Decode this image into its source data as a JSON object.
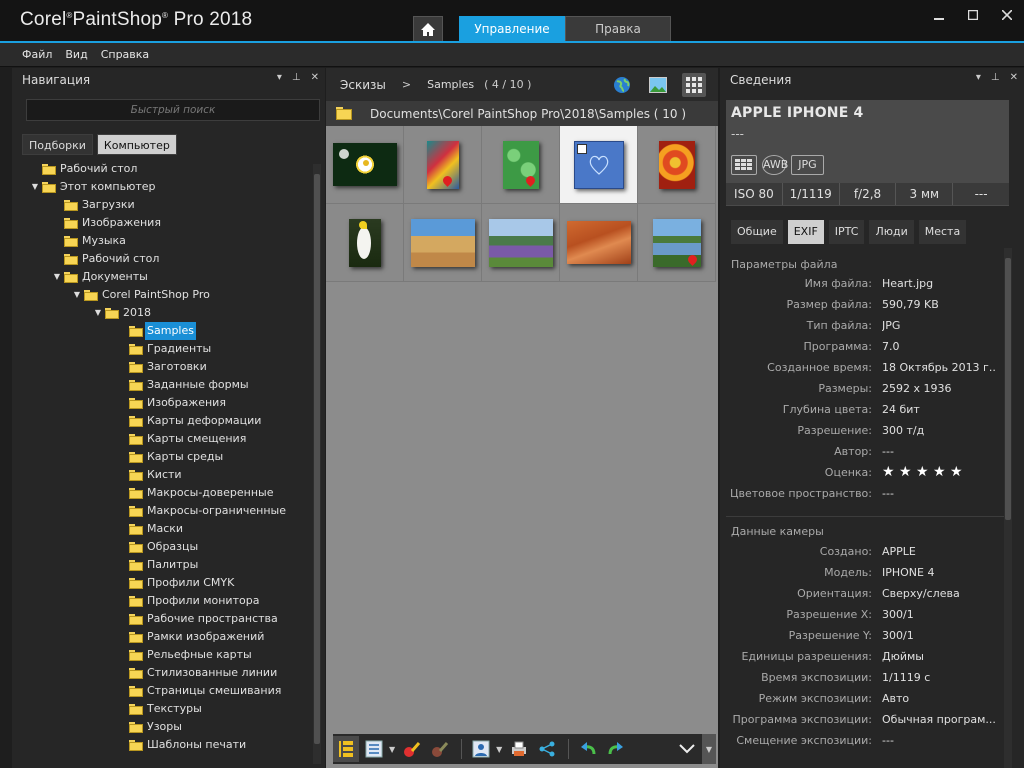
{
  "app": {
    "title": "Corel",
    "title_reg": "®",
    "title_rest": "PaintShop",
    "title_tm": "®",
    "title_end": "Pro 2018",
    "min_icon": "minimize-icon",
    "max_icon": "maximize-icon",
    "close_icon": "close-icon"
  },
  "tabs": {
    "home_icon": "home-icon",
    "manage": "Управление",
    "edit": "Правка"
  },
  "menu": {
    "file": "Файл",
    "view": "Вид",
    "help": "Справка"
  },
  "left": {
    "title": "Навигация",
    "search_placeholder": "Быстрый поиск",
    "toggle_collections": "Подборки",
    "toggle_computer": "Компьютер",
    "tree": [
      {
        "label": "Рабочий стол",
        "level": 1,
        "arrow": ""
      },
      {
        "label": "Этот компьютер",
        "level": 1,
        "arrow": "▼"
      },
      {
        "label": "Загрузки",
        "level": 2,
        "arrow": ""
      },
      {
        "label": "Изображения",
        "level": 2,
        "arrow": ""
      },
      {
        "label": "Музыка",
        "level": 2,
        "arrow": ""
      },
      {
        "label": "Рабочий стол",
        "level": 2,
        "arrow": ""
      },
      {
        "label": "Документы",
        "level": 2,
        "arrow": "▼"
      },
      {
        "label": "Corel PaintShop Pro",
        "level": 3,
        "arrow": "▼"
      },
      {
        "label": "2018",
        "level": 4,
        "arrow": "▼"
      },
      {
        "label": "Samples",
        "level": 5,
        "arrow": "",
        "selected": true
      },
      {
        "label": "Градиенты",
        "level": 5,
        "arrow": ""
      },
      {
        "label": "Заготовки",
        "level": 5,
        "arrow": ""
      },
      {
        "label": "Заданные формы",
        "level": 5,
        "arrow": ""
      },
      {
        "label": "Изображения",
        "level": 5,
        "arrow": ""
      },
      {
        "label": "Карты деформации",
        "level": 5,
        "arrow": ""
      },
      {
        "label": "Карты смещения",
        "level": 5,
        "arrow": ""
      },
      {
        "label": "Карты среды",
        "level": 5,
        "arrow": ""
      },
      {
        "label": "Кисти",
        "level": 5,
        "arrow": ""
      },
      {
        "label": "Макросы-доверенные",
        "level": 5,
        "arrow": ""
      },
      {
        "label": "Макросы-ограниченные",
        "level": 5,
        "arrow": ""
      },
      {
        "label": "Маски",
        "level": 5,
        "arrow": ""
      },
      {
        "label": "Образцы",
        "level": 5,
        "arrow": ""
      },
      {
        "label": "Палитры",
        "level": 5,
        "arrow": ""
      },
      {
        "label": "Профили CMYK",
        "level": 5,
        "arrow": ""
      },
      {
        "label": "Профили монитора",
        "level": 5,
        "arrow": ""
      },
      {
        "label": "Рабочие пространства",
        "level": 5,
        "arrow": ""
      },
      {
        "label": "Рамки изображений",
        "level": 5,
        "arrow": ""
      },
      {
        "label": "Рельефные карты",
        "level": 5,
        "arrow": ""
      },
      {
        "label": "Стилизованные линии",
        "level": 5,
        "arrow": ""
      },
      {
        "label": "Страницы смешивания",
        "level": 5,
        "arrow": ""
      },
      {
        "label": "Текстуры",
        "level": 5,
        "arrow": ""
      },
      {
        "label": "Узоры",
        "level": 5,
        "arrow": ""
      },
      {
        "label": "Шаблоны печати",
        "level": 5,
        "arrow": ""
      }
    ]
  },
  "center": {
    "crumb": "Эскизы",
    "sep": ">",
    "current": "Samples",
    "count": "( 4 / 10 )",
    "path": "Documents\\Corel PaintShop Pro\\2018\\Samples ( 10 )",
    "thumbs": [
      {
        "name": "daisy",
        "geo": false
      },
      {
        "name": "parrot-art",
        "geo": true
      },
      {
        "name": "leaves",
        "geo": true
      },
      {
        "name": "heart",
        "geo": false,
        "selected": true
      },
      {
        "name": "rose",
        "geo": false
      },
      {
        "name": "cockatoo",
        "geo": false
      },
      {
        "name": "desert-rocks",
        "geo": false
      },
      {
        "name": "meadow",
        "geo": false
      },
      {
        "name": "red-rocks",
        "geo": false
      },
      {
        "name": "river",
        "geo": true
      }
    ]
  },
  "right": {
    "title": "Сведения",
    "model": "APPLE IPHONE 4",
    "dash": "---",
    "badge_awb": "AWB",
    "badge_jpg": "JPG",
    "stats": [
      "ISO 80",
      "1/1119",
      "f/2,8",
      "3 мм",
      "---"
    ],
    "tabs": [
      "Общие",
      "EXIF",
      "IPTC",
      "Люди",
      "Места"
    ],
    "section_file": "Параметры файла",
    "file_props": [
      {
        "k": "Имя файла:",
        "v": "Heart.jpg"
      },
      {
        "k": "Размер файла:",
        "v": "590,79 KB"
      },
      {
        "k": "Тип файла:",
        "v": "JPG"
      },
      {
        "k": "Программа:",
        "v": "7.0"
      },
      {
        "k": "Созданное время:",
        "v": "18 Октябрь 2013 г...."
      },
      {
        "k": "Размеры:",
        "v": "2592 x 1936"
      },
      {
        "k": "Глубина цвета:",
        "v": "24 бит"
      },
      {
        "k": "Разрешение:",
        "v": "300 т/д"
      },
      {
        "k": "Автор:",
        "v": "---"
      },
      {
        "k": "Оценка:",
        "v": "★ ★ ★ ★ ★"
      },
      {
        "k": "Цветовое пространство:",
        "v": "---"
      }
    ],
    "section_camera": "Данные камеры",
    "camera_props": [
      {
        "k": "Создано:",
        "v": "APPLE"
      },
      {
        "k": "Модель:",
        "v": "IPHONE 4"
      },
      {
        "k": "Ориентация:",
        "v": "Сверху/слева"
      },
      {
        "k": "Разрешение X:",
        "v": "300/1"
      },
      {
        "k": "Разрешение Y:",
        "v": "300/1"
      },
      {
        "k": "Единицы разрешения:",
        "v": "Дюймы"
      },
      {
        "k": "Время экспозиции:",
        "v": "1/1119 с"
      },
      {
        "k": "Режим экспозиции:",
        "v": "Авто"
      },
      {
        "k": "Программа экспозиции:",
        "v": "Обычная програм..."
      },
      {
        "k": "Смещение экспозиции:",
        "v": "---"
      }
    ]
  },
  "colors": {
    "accent": "#1aa0e0",
    "folder": "#f7d554",
    "selection": "#1a8fd6"
  }
}
